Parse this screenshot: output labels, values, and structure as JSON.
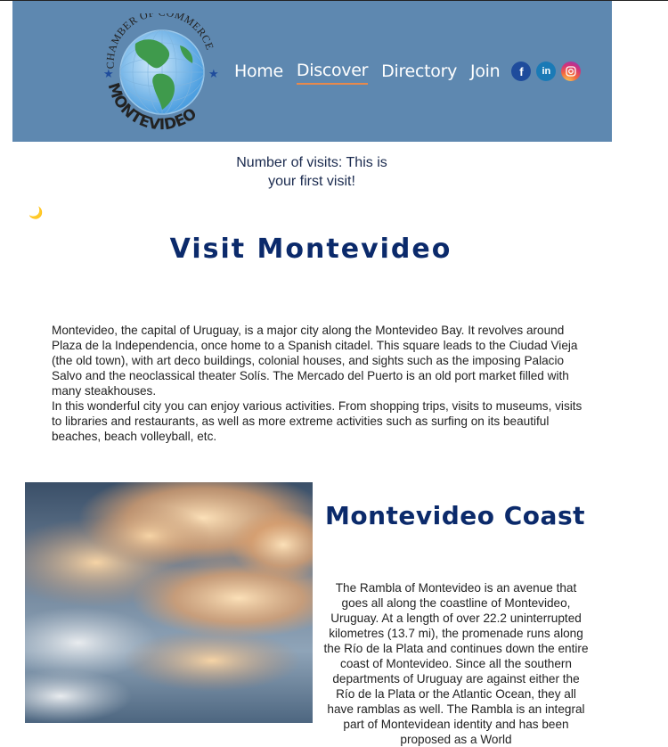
{
  "header": {
    "logo_text_top": "CHAMBER OF COMMERCE",
    "logo_text_bottom": "MONTEVIDEO",
    "nav": [
      {
        "label": "Home",
        "active": false
      },
      {
        "label": "Discover",
        "active": true
      },
      {
        "label": "Directory",
        "active": false
      },
      {
        "label": "Join",
        "active": false
      }
    ],
    "social": {
      "facebook": "f",
      "linkedin": "in"
    },
    "bg_color": "#5e88b0",
    "active_underline": "#e8894c"
  },
  "visits": {
    "text": "Number of visits: This is your first visit!"
  },
  "theme_toggle": {
    "icon": "🌙"
  },
  "main": {
    "title": "Visit Montevideo",
    "intro": [
      "Montevideo, the capital of Uruguay, is a major city along the Montevideo Bay. It revolves around Plaza de la Independencia, once home to a Spanish citadel. This square leads to the Ciudad Vieja (the old town), with art deco buildings, colonial houses, and sights such as the imposing Palacio Salvo and the neoclassical theater Solís. The Mercado del Puerto is an old port market filled with many steakhouses.",
      "In this wonderful city you can enjoy various activities. From shopping trips, visits to museums, visits to libraries and restaurants, as well as more extreme activities such as surfing on its beautiful beaches, beach volleyball, etc."
    ],
    "title_color": "#0b2a6b"
  },
  "coast": {
    "title": "Montevideo Coast",
    "text": "The Rambla of Montevideo is an avenue that goes all along the coastline of Montevideo, Uruguay. At a length of over 22.2 uninterrupted kilometres (13.7 mi), the promenade runs along the Río de la Plata and continues down the entire coast of Montevideo. Since all the southern departments of Uruguay are against either the Río de la Plata or the Atlantic Ocean, they all have ramblas as well. The Rambla is an integral part of Montevidean identity and has been proposed as a World"
  }
}
